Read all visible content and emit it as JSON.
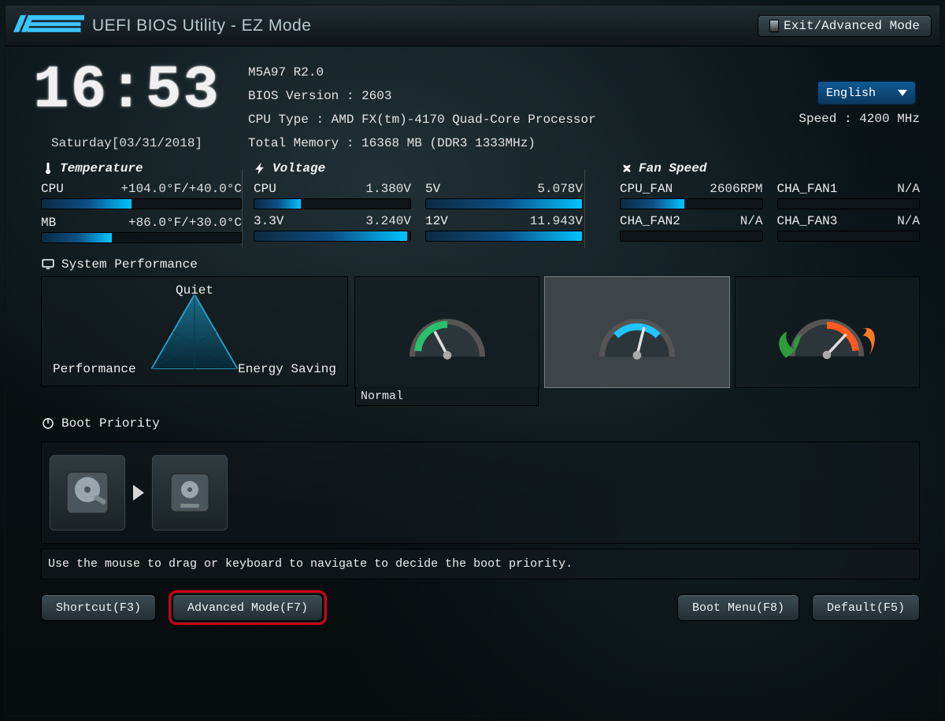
{
  "title": "UEFI BIOS Utility - EZ Mode",
  "exit_label": "Exit/Advanced Mode",
  "language": "English",
  "clock": {
    "time": "16:53",
    "date": "Saturday[03/31/2018]"
  },
  "info": {
    "board": "M5A97 R2.0",
    "bios_version_label": "BIOS Version : 2603",
    "cpu_type_label": "CPU Type : AMD FX(tm)-4170 Quad-Core Processor",
    "memory_label": "Total Memory : 16368 MB (DDR3 1333MHz)",
    "speed_label": "Speed : 4200 MHz"
  },
  "sections": {
    "temperature": "Temperature",
    "voltage": "Voltage",
    "fan_speed": "Fan Speed",
    "system_performance": "System Performance",
    "boot_priority": "Boot Priority"
  },
  "temperature": {
    "cpu": {
      "label": "CPU",
      "value": "+104.0°F/+40.0°C",
      "pct": 45
    },
    "mb": {
      "label": "MB",
      "value": "+86.0°F/+30.0°C",
      "pct": 35
    }
  },
  "voltage": {
    "cpu": {
      "label": "CPU",
      "value": "1.380V",
      "pct": 30
    },
    "v5": {
      "label": "5V",
      "value": "5.078V",
      "pct": 100
    },
    "v33": {
      "label": "3.3V",
      "value": "3.240V",
      "pct": 98
    },
    "v12": {
      "label": "12V",
      "value": "11.943V",
      "pct": 100
    }
  },
  "fans": {
    "cpu_fan": {
      "label": "CPU_FAN",
      "value": "2606RPM",
      "pct": 45
    },
    "cha_fan1": {
      "label": "CHA_FAN1",
      "value": "N/A",
      "pct": 0
    },
    "cha_fan2": {
      "label": "CHA_FAN2",
      "value": "N/A",
      "pct": 0
    },
    "cha_fan3": {
      "label": "CHA_FAN3",
      "value": "N/A",
      "pct": 0
    }
  },
  "performance": {
    "labels": {
      "quiet": "Quiet",
      "performance": "Performance",
      "energy": "Energy Saving"
    },
    "caption": "Normal"
  },
  "hint": "Use the mouse to drag or keyboard to navigate to decide the boot priority.",
  "buttons": {
    "shortcut": "Shortcut(F3)",
    "advanced": "Advanced Mode(F7)",
    "boot_menu": "Boot Menu(F8)",
    "default": "Default(F5)"
  }
}
